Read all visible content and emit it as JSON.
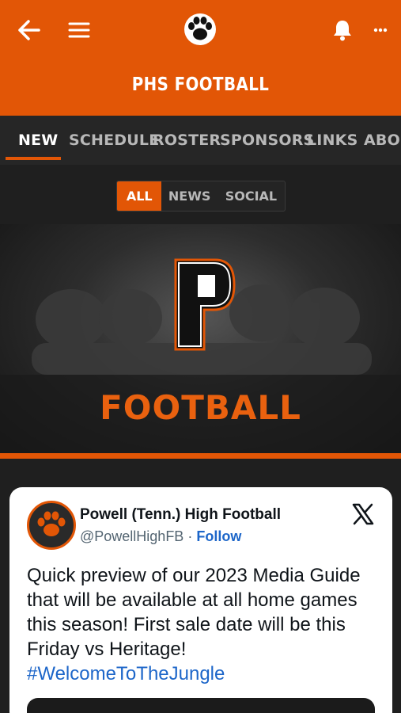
{
  "header": {
    "title": "PHS FOOTBALL",
    "icons": [
      "back-arrow-icon",
      "hamburger-menu-icon",
      "paw-print-icon",
      "bell-icon",
      "more-icon"
    ]
  },
  "tabs": [
    {
      "label": "NEW",
      "active": true
    },
    {
      "label": "SCHEDULE"
    },
    {
      "label": "ROSTER"
    },
    {
      "label": "SPONSORS"
    },
    {
      "label": "LINKS"
    },
    {
      "label": "ABOUT"
    }
  ],
  "filters": [
    {
      "label": "ALL",
      "active": true
    },
    {
      "label": "NEWS"
    },
    {
      "label": "SOCIAL"
    }
  ],
  "banner": {
    "letter": "P",
    "word": "FOOTBALL"
  },
  "post": {
    "account_name": "Powell (Tenn.) High Football",
    "handle": "@PowellHighFB",
    "separator": "·",
    "follow_label": "Follow",
    "text": "Quick preview of our 2023 Media Guide that will be available at all home games this season! First sale date will be this Friday vs Heritage!",
    "hashtag": "#WelcomeToTheJungle"
  },
  "colors": {
    "brand_orange": "#e25606",
    "link_blue": "#1d66c9",
    "dark_bg": "#1f1f1f"
  }
}
